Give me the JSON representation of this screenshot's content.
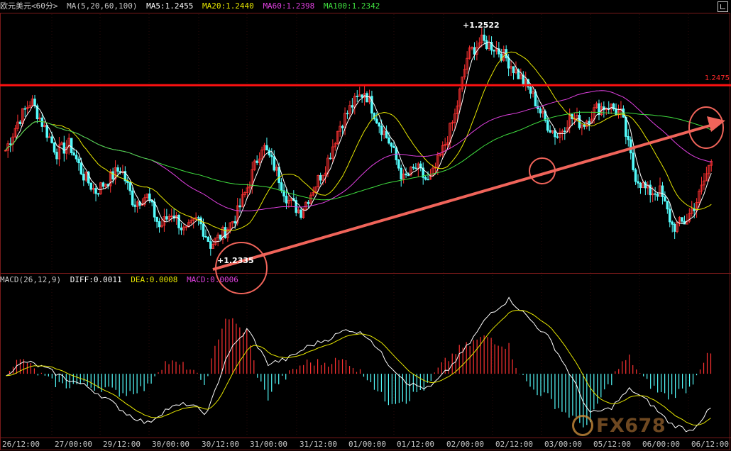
{
  "header": {
    "symbol": "欧元美元<60分>",
    "ma_label": "MA(5,20,60,100)",
    "ma5": "MA5:1.2455",
    "ma20": "MA20:1.2440",
    "ma60": "MA60:1.2398",
    "ma100": "MA100:1.2342"
  },
  "macd_header": {
    "label": "MACD(26,12,9)",
    "diff": "DIFF:0.0011",
    "dea": "DEA:0.0008",
    "macd": "MACD:0.0006"
  },
  "annotations": {
    "high": "+1.2522",
    "low": "+1.2335",
    "resistance": "1.2475"
  },
  "watermark": "FX678",
  "colors": {
    "background": "#000000",
    "up_candle": "#ff3232",
    "down_candle": "#54fcfc",
    "ma5": "#ffffff",
    "ma20": "#e6e600",
    "ma60": "#e040e0",
    "ma100": "#40e040",
    "annotation": "#f0645a",
    "resistance_line": "#ff1010"
  },
  "chart_data": {
    "type": "candlestick",
    "instrument": "欧元美元 60分",
    "x_tick_labels": [
      "26/12:00",
      "27/00:00",
      "29/12:00",
      "30/00:00",
      "30/12:00",
      "31/00:00",
      "31/12:00",
      "01/00:00",
      "01/12:00",
      "02/00:00",
      "02/12:00",
      "03/00:00",
      "05/12:00",
      "06/00:00",
      "06/12:00"
    ],
    "price_ylim": [
      1.2318,
      1.2535
    ],
    "close_path": [
      1.242,
      1.2445,
      1.2462,
      1.244,
      1.2418,
      1.2425,
      1.24,
      1.2385,
      1.2395,
      1.2405,
      1.2375,
      1.2382,
      1.2355,
      1.2368,
      1.235,
      1.2362,
      1.234,
      1.235,
      1.2365,
      1.2393,
      1.2425,
      1.2405,
      1.2378,
      1.2368,
      1.2388,
      1.2408,
      1.244,
      1.2458,
      1.247,
      1.2445,
      1.2425,
      1.2395,
      1.2405,
      1.2392,
      1.2418,
      1.2448,
      1.25,
      1.2512,
      1.2508,
      1.2498,
      1.2483,
      1.2468,
      1.2445,
      1.2432,
      1.2448,
      1.2442,
      1.2455,
      1.2458,
      1.245,
      1.24,
      1.2385,
      1.2385,
      1.2355,
      1.236,
      1.238,
      1.2412
    ],
    "high": 1.2522,
    "low": 1.2335,
    "resistance_level": 1.2475,
    "ma_values": {
      "MA5": 1.2455,
      "MA20": 1.244,
      "MA60": 1.2398,
      "MA100": 1.2342
    },
    "macd": {
      "params": [
        26,
        12,
        9
      ],
      "diff": 0.0011,
      "dea": 0.0008,
      "macd": 0.0006,
      "diff_path": [
        0.0,
        0.0005,
        0.0002,
        -0.0002,
        -0.0005,
        -0.001,
        -0.0016,
        -0.002,
        -0.0014,
        -0.0012,
        -0.0016,
        0.0008,
        0.0018,
        0.0004,
        0.0006,
        0.0011,
        0.0014,
        0.0018,
        0.0015,
        0.0004,
        -0.0004,
        -0.0006,
        0.0002,
        0.0012,
        0.0024,
        0.003,
        0.0022,
        0.0014,
        0.0,
        -0.0016,
        -0.0014,
        -0.0006,
        -0.0012,
        -0.002,
        -0.0023,
        -0.0014
      ],
      "ylim": [
        -0.0025,
        0.0035
      ]
    }
  }
}
